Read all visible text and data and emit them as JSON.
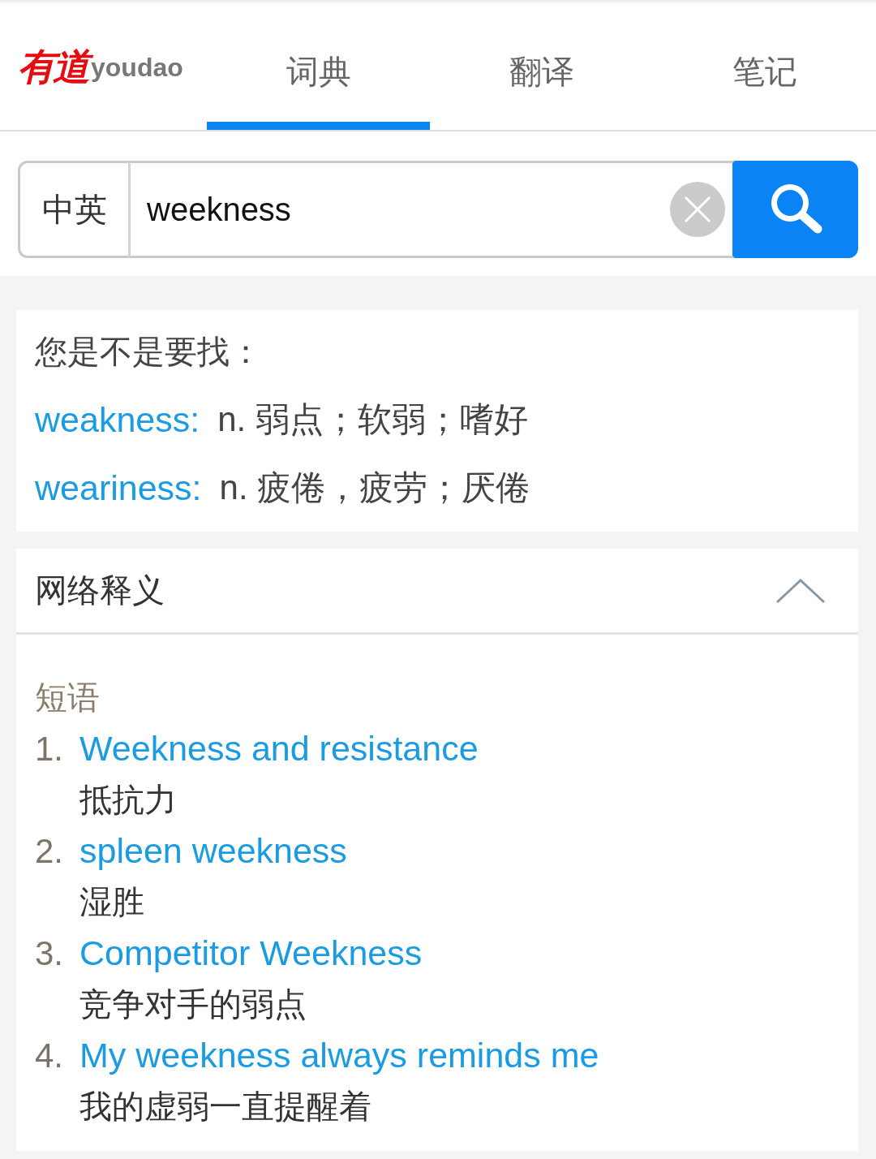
{
  "header": {
    "logo": {
      "mark": "有道",
      "wordmark": "youdao"
    },
    "tabs": [
      {
        "label": "词典",
        "selected": true
      },
      {
        "label": "翻译",
        "selected": false
      },
      {
        "label": "笔记",
        "selected": false
      }
    ]
  },
  "search": {
    "language": "中英",
    "value": "weekness"
  },
  "suggestions": {
    "title": "您是不是要找：",
    "items": [
      {
        "word": "weakness:",
        "definition": "n. 弱点；软弱；嗜好"
      },
      {
        "word": "weariness:",
        "definition": "n. 疲倦，疲劳；厌倦"
      }
    ]
  },
  "web_definitions": {
    "title": "网络释义",
    "expanded": true,
    "section_label": "短语",
    "phrases": [
      {
        "number": "1.",
        "phrase": "Weekness and resistance",
        "translation": "抵抗力"
      },
      {
        "number": "2.",
        "phrase": "spleen weekness",
        "translation": "湿胜"
      },
      {
        "number": "3.",
        "phrase": "Competitor Weekness",
        "translation": "竞争对手的弱点"
      },
      {
        "number": "4.",
        "phrase": "My weekness always reminds me",
        "translation": "我的虚弱一直提醒着"
      }
    ]
  }
}
